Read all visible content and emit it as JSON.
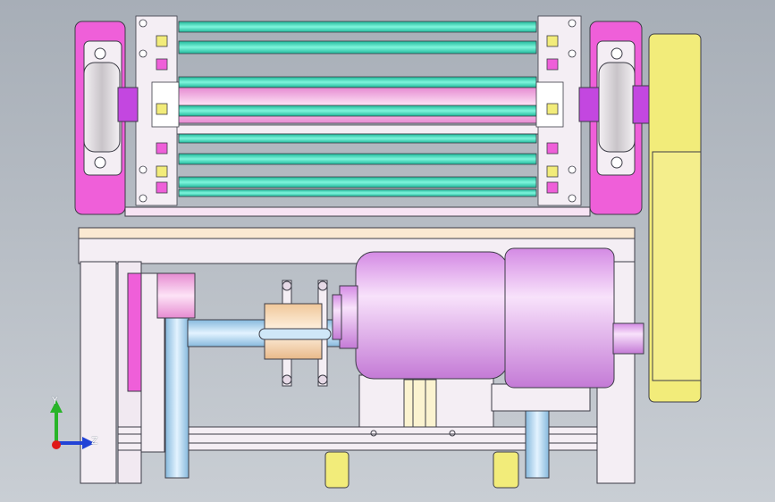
{
  "viewport": {
    "colors": {
      "bg_top": "#a7aeb7",
      "bg_bottom": "#c9ced4",
      "frame": "#f4eef4",
      "magenta": "#ef5fd9",
      "magenta_light": "#f7a6ee",
      "teal": "#39d9b8",
      "pink": "#f6b2e6",
      "motor": "#e6a8f0",
      "motor_dark": "#c981dc",
      "pipe": "#a9d4f2",
      "yellow": "#f2ec7a",
      "cream": "#fbe9d2",
      "outline": "#3c3c46"
    }
  },
  "triad": {
    "y_label": "Y",
    "z_label": "Z",
    "colors": {
      "y_axis": "#28b428",
      "z_axis": "#2243d6",
      "x_axis": "#e01818"
    }
  }
}
